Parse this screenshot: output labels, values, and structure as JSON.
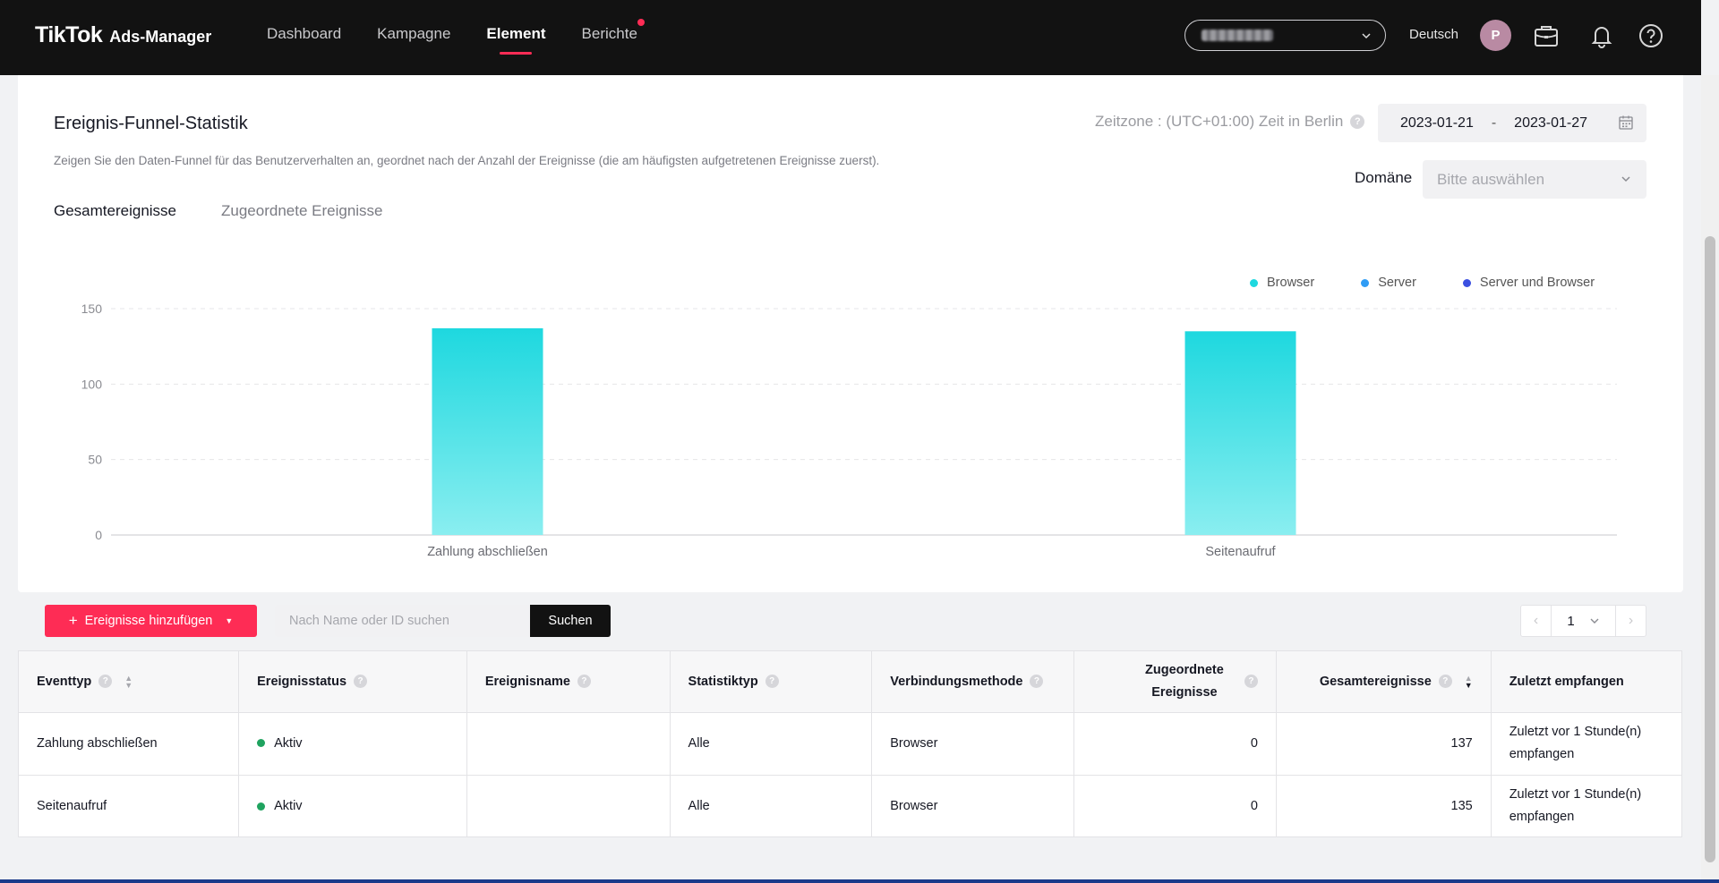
{
  "nav": {
    "logo_main": "TikTok",
    "logo_sub": "Ads-Manager",
    "items": [
      {
        "label": "Dashboard"
      },
      {
        "label": "Kampagne"
      },
      {
        "label": "Element"
      },
      {
        "label": "Berichte"
      }
    ],
    "language": "Deutsch",
    "avatar_initial": "P"
  },
  "funnel": {
    "title": "Ereignis-Funnel-Statistik",
    "description": "Zeigen Sie den Daten-Funnel für das Benutzerverhalten an, geordnet nach der Anzahl der Ereignisse (die am häufigsten aufgetretenen Ereignisse zuerst).",
    "timezone": "Zeitzone : (UTC+01:00) Zeit in Berlin",
    "date_start": "2023-01-21",
    "date_sep": "-",
    "date_end": "2023-01-27",
    "domain_label": "Domäne",
    "domain_placeholder": "Bitte auswählen",
    "tabs": [
      {
        "label": "Gesamtereignisse"
      },
      {
        "label": "Zugeordnete Ereignisse"
      }
    ]
  },
  "chart_data": {
    "type": "bar",
    "categories": [
      "Zahlung abschließen",
      "Seitenaufruf"
    ],
    "series": [
      {
        "name": "Browser",
        "values": [
          137,
          135
        ]
      },
      {
        "name": "Server",
        "values": [
          0,
          0
        ]
      },
      {
        "name": "Server und Browser",
        "values": [
          0,
          0
        ]
      }
    ],
    "colors": {
      "Browser": "#1ed8df",
      "Server": "#2f9cf5",
      "Server und Browser": "#3b4fe0"
    },
    "yticks": [
      0,
      50,
      100,
      150
    ],
    "ylim": [
      0,
      150
    ],
    "grid": true,
    "legend": "top-right"
  },
  "toolbar": {
    "add_label": "Ereignisse hinzufügen",
    "search_placeholder": "Nach Name oder ID suchen",
    "search_button": "Suchen",
    "page": "1"
  },
  "table": {
    "headers": {
      "eventtyp": "Eventtyp",
      "status": "Ereignisstatus",
      "name": "Ereignisname",
      "stattyp": "Statistiktyp",
      "method": "Verbindungsmethode",
      "assigned": "Zugeordnete Ereignisse",
      "total": "Gesamtereignisse",
      "last": "Zuletzt empfangen"
    },
    "rows": [
      {
        "eventtyp": "Zahlung abschließen",
        "status": "Aktiv",
        "name": "",
        "stattyp": "Alle",
        "method": "Browser",
        "assigned": "0",
        "total": "137",
        "last": "Zuletzt vor 1 Stunde(n) empfangen"
      },
      {
        "eventtyp": "Seitenaufruf",
        "status": "Aktiv",
        "name": "",
        "stattyp": "Alle",
        "method": "Browser",
        "assigned": "0",
        "total": "135",
        "last": "Zuletzt vor 1 Stunde(n) empfangen"
      }
    ]
  }
}
